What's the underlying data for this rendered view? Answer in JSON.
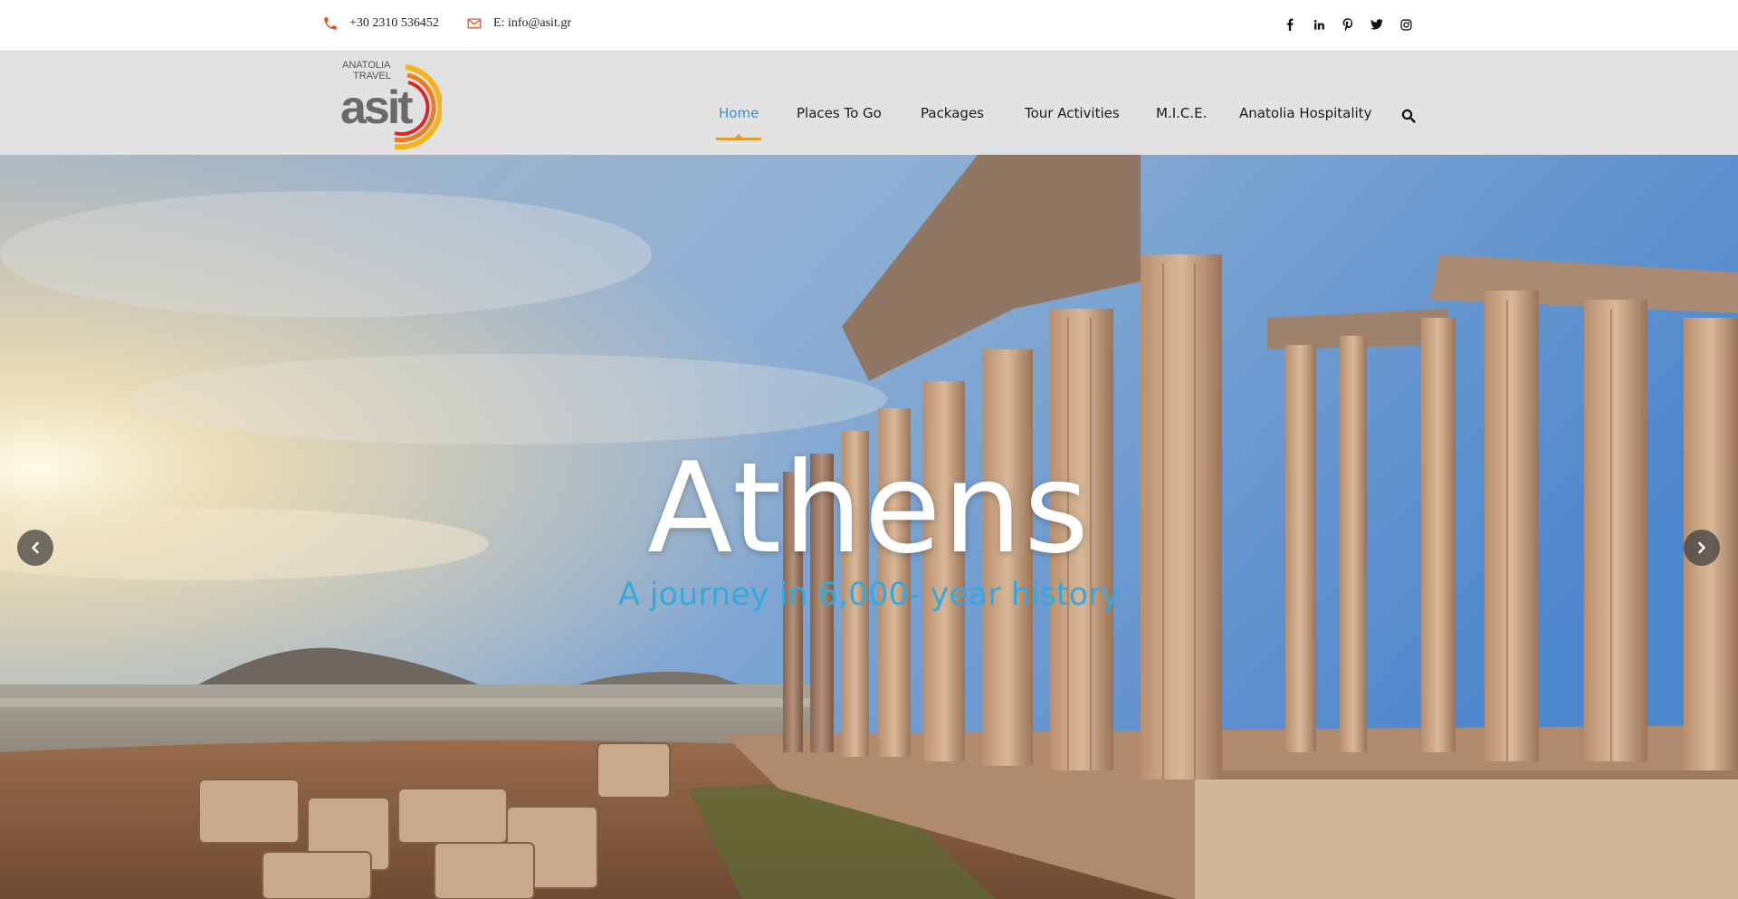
{
  "topbar": {
    "phone": "+30 2310 536452",
    "email": "E: info@asit.gr",
    "accent_color": "#e0552a",
    "social": [
      {
        "icon": "facebook-icon"
      },
      {
        "icon": "linkedin-icon"
      },
      {
        "icon": "pinterest-icon"
      },
      {
        "icon": "twitter-icon"
      },
      {
        "icon": "instagram-icon"
      }
    ]
  },
  "logo": {
    "line1": "ANATOLIA",
    "line2": "TRAVEL",
    "wordmark": "asit"
  },
  "nav": {
    "items": [
      {
        "label": "Home",
        "active": true
      },
      {
        "label": "Places To Go"
      },
      {
        "label": "Packages"
      },
      {
        "label": "Tour Activities"
      },
      {
        "label": "M.I.C.E."
      },
      {
        "label": "Anatolia Hospitality"
      }
    ],
    "active_color": "#3a8ed0",
    "underline_color": "#e59a2b",
    "search_icon": "search-icon"
  },
  "hero": {
    "title": "Athens",
    "subtitle": "A journey in 6,000- year history",
    "subtitle_color": "#35a8dd",
    "prev_icon": "chevron-left-icon",
    "next_icon": "chevron-right-icon"
  }
}
